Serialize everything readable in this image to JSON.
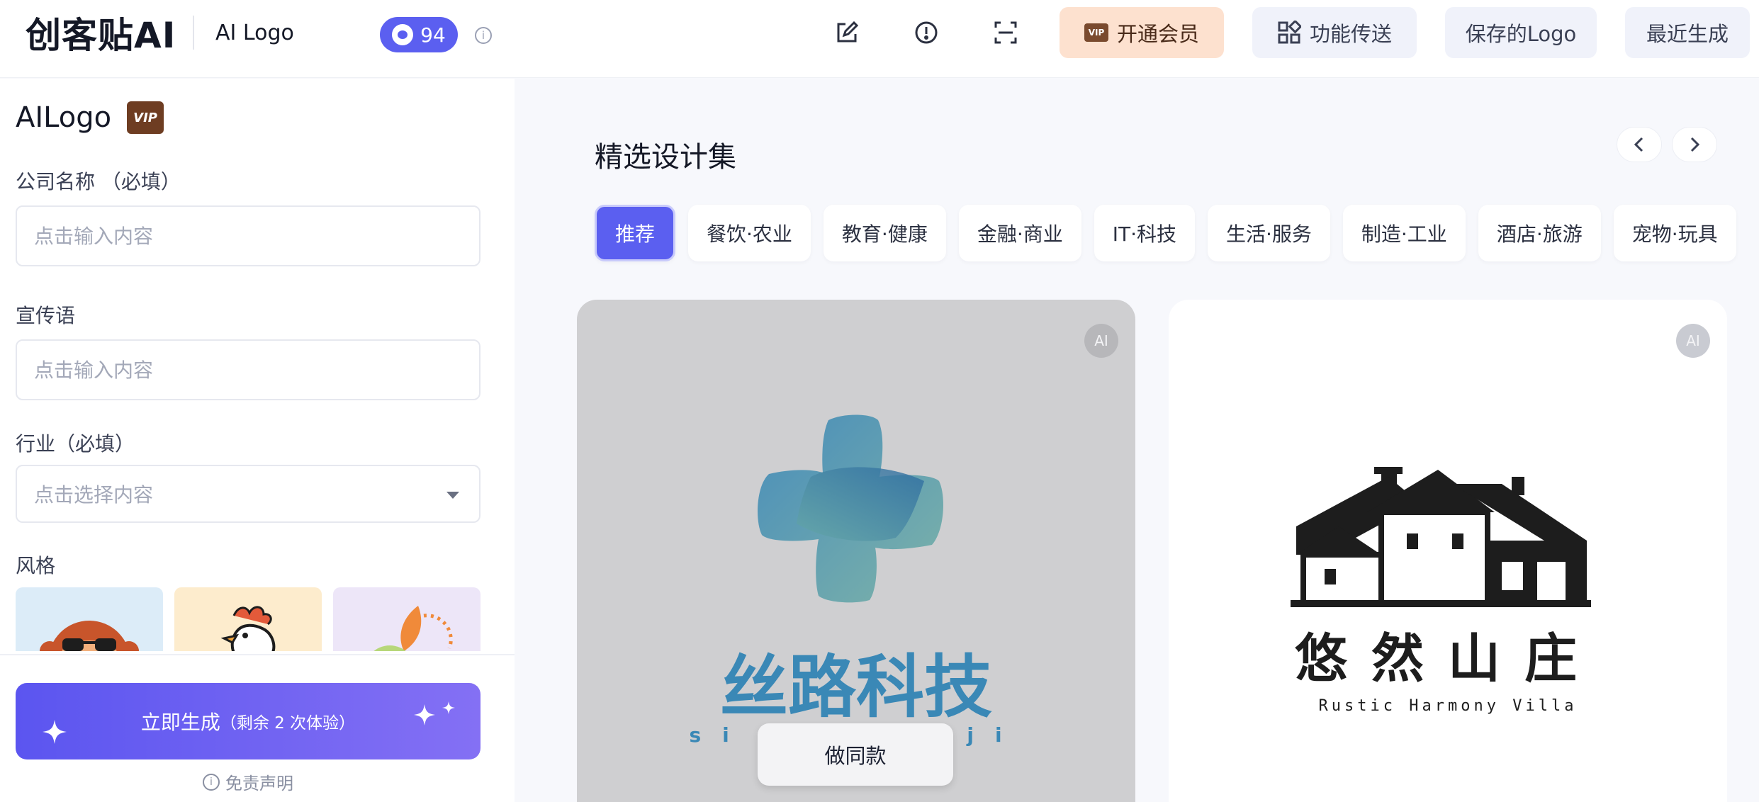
{
  "header": {
    "brand": "创客贴AI",
    "app_name": "AI Logo",
    "credits": "94",
    "buttons": {
      "vip": "开通会员",
      "feature_transfer": "功能传送",
      "saved_logo": "保存的Logo",
      "recent": "最近生成"
    }
  },
  "sidebar": {
    "title": "AILogo",
    "vip_badge": "VIP",
    "company_label": "公司名称 （必填）",
    "company_placeholder": "点击输入内容",
    "slogan_label": "宣传语",
    "slogan_placeholder": "点击输入内容",
    "industry_label": "行业（必填）",
    "industry_placeholder": "点击选择内容",
    "style_label": "风格",
    "generate_main": "立即生成",
    "generate_sub": "（剩余 2 次体验）",
    "disclaimer": "免责声明"
  },
  "main": {
    "title": "精选设计集",
    "categories": [
      "推荐",
      "餐饮·农业",
      "教育·健康",
      "金融·商业",
      "IT·科技",
      "生活·服务",
      "制造·工业",
      "酒店·旅游",
      "宠物·玩具"
    ],
    "cards": [
      {
        "ai": "AI",
        "logo_text": "丝路科技",
        "logo_sub": "si lu ke ji",
        "action": "做同款"
      },
      {
        "ai": "AI",
        "logo_text": "悠然山庄",
        "logo_sub": "Rustic Harmony Villa"
      }
    ]
  },
  "colors": {
    "accent": "#5b5ff0",
    "vip_bg": "#fde1cf",
    "logo_blue": "#3a86b8",
    "logo_teal": "#6fa8a0"
  }
}
